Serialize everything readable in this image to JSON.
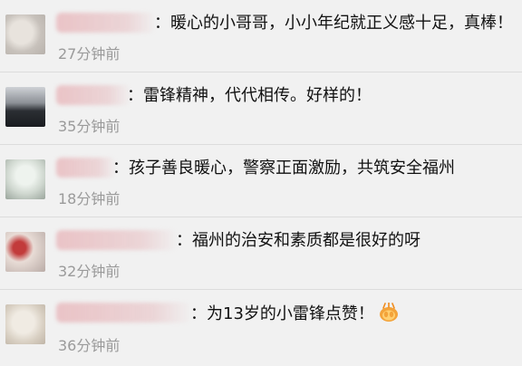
{
  "comments": [
    {
      "text": "：暖心的小哥哥，小小年纪就正义感十足，真棒！",
      "time": "27分钟前"
    },
    {
      "text": "：雷锋精神，代代相传。好样的！",
      "time": "35分钟前"
    },
    {
      "text": "：孩子善良暖心，警察正面激励，共筑安全福州",
      "time": "18分钟前"
    },
    {
      "text": "：福州的治安和素质都是很好的呀",
      "time": "32分钟前"
    },
    {
      "text": "：为13岁的小雷锋点赞！",
      "time": "36分钟前",
      "trailing_icon": "clapping-hands-emoji-icon"
    }
  ]
}
